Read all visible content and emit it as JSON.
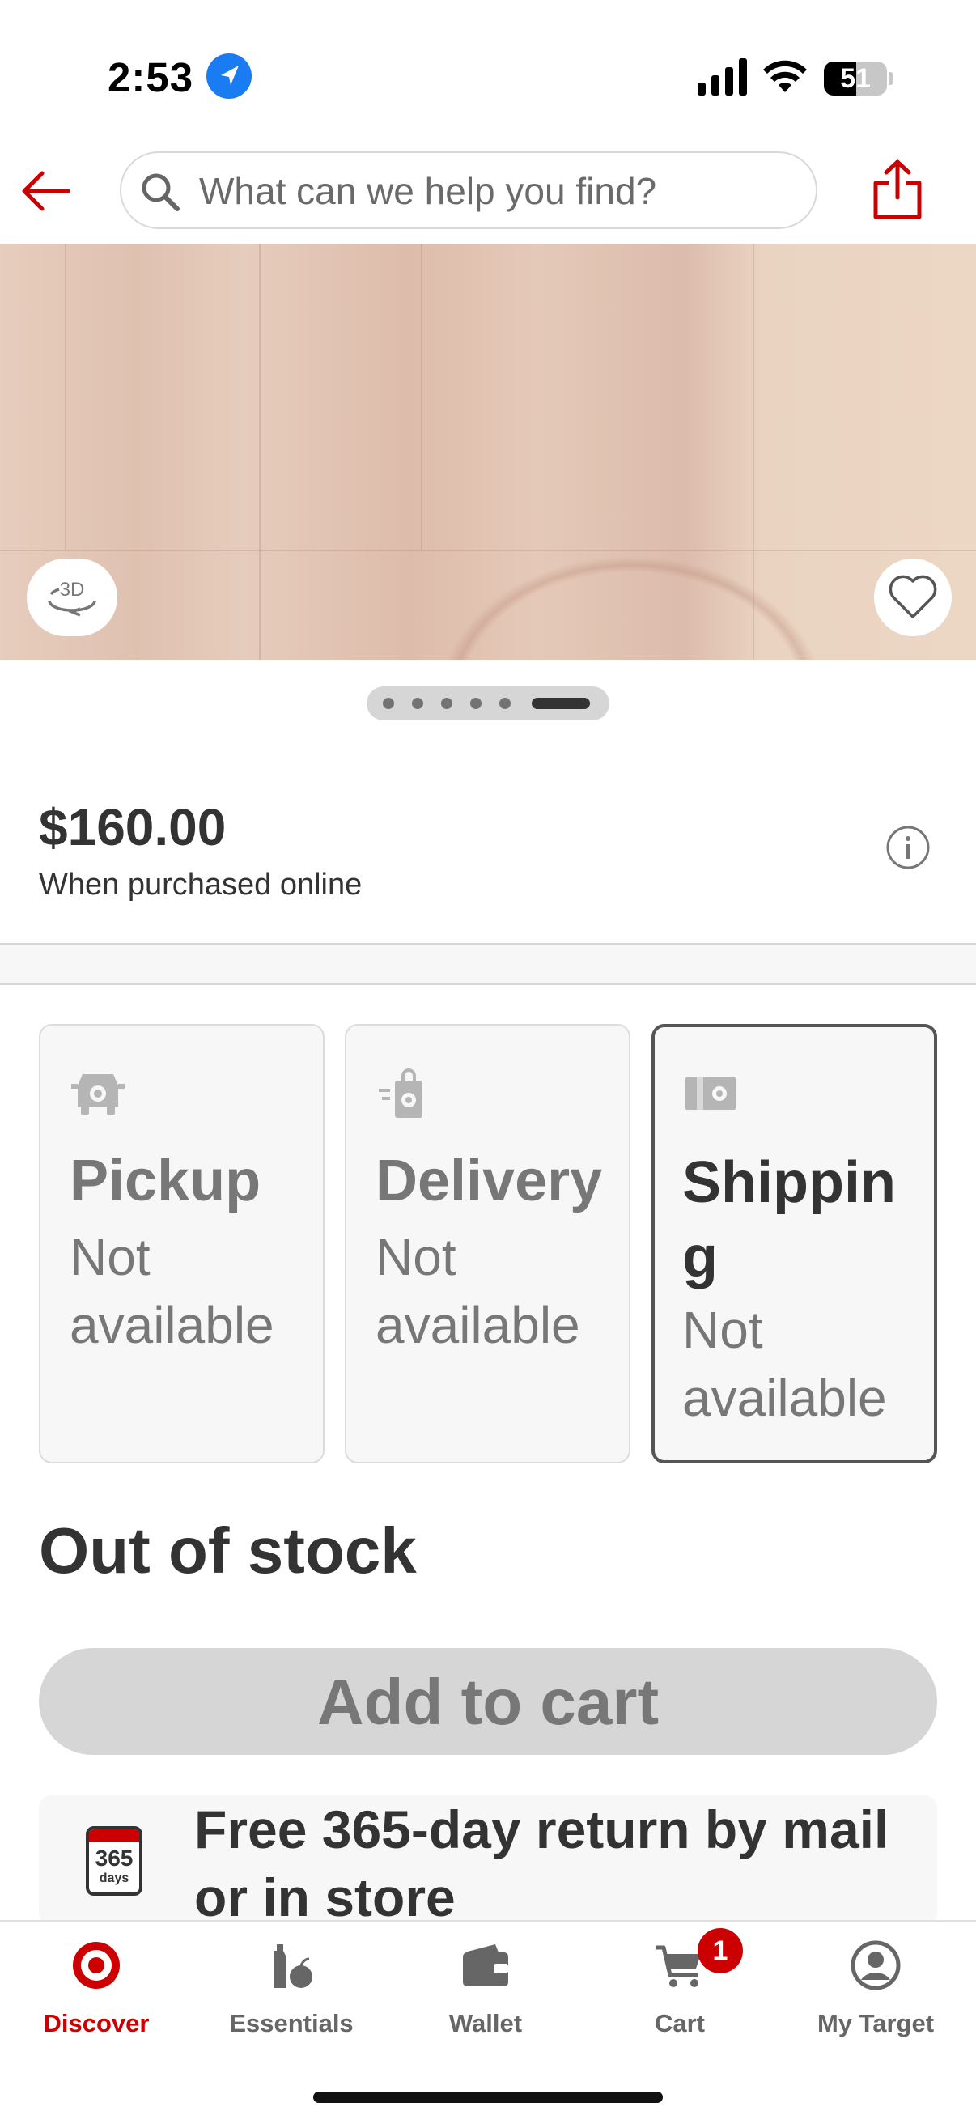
{
  "status_bar": {
    "time": "2:53",
    "battery": "51"
  },
  "search": {
    "placeholder": "What can we help you find?"
  },
  "product": {
    "price": "$160.00",
    "price_note": "When purchased online",
    "carousel": {
      "count": 6,
      "active": 6
    }
  },
  "fulfillment": [
    {
      "title": "Pickup",
      "status": "Not available",
      "icon": "pickup-car-icon",
      "selected": false
    },
    {
      "title": "Delivery",
      "status": "Not available",
      "icon": "delivery-bag-icon",
      "selected": false
    },
    {
      "title": "Shipping",
      "status": "Not available",
      "icon": "shipping-box-icon",
      "selected": true
    }
  ],
  "stock_status": "Out of stock",
  "add_to_cart_label": "Add to cart",
  "returns": {
    "calendar_number": "365",
    "calendar_unit": "days",
    "text": "Free 365-day return by mail or in store"
  },
  "tabs": [
    {
      "label": "Discover",
      "icon": "target-bullseye-icon",
      "active": true
    },
    {
      "label": "Essentials",
      "icon": "essentials-icon",
      "active": false
    },
    {
      "label": "Wallet",
      "icon": "wallet-icon",
      "active": false
    },
    {
      "label": "Cart",
      "icon": "cart-icon",
      "active": false
    },
    {
      "label": "My Target",
      "icon": "account-icon",
      "active": false
    }
  ],
  "cart_badge": "1",
  "colors": {
    "brand_red": "#cc0000",
    "text_dark": "#333333",
    "muted": "#777777"
  }
}
